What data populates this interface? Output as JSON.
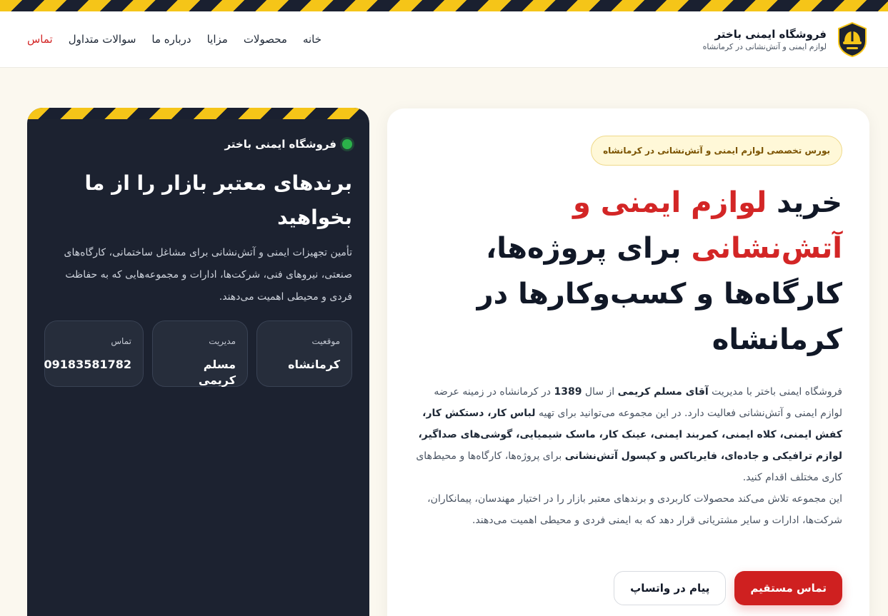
{
  "brand": {
    "title": "فروشگاه ایمنی باختر",
    "subtitle": "لوازم ایمنی و آتش‌نشانی در کرمانشاه"
  },
  "nav": {
    "home": "خانه",
    "products": "محصولات",
    "features": "مزایا",
    "about": "درباره ما",
    "faq": "سوالات متداول",
    "contact": "تماس"
  },
  "hero": {
    "badge": "بورس تخصصی لوازم ایمنی و آتش‌نشانی در کرمانشاه",
    "title_1": "خرید ",
    "title_highlight_1": "لوازم ایمنی و",
    "title_highlight_2": "آتش‌نشانی",
    "title_2": " برای پروژه‌ها، کارگاه‌ها و کسب‌وکارها در کرمانشاه",
    "p1_a": "فروشگاه ایمنی باختر با مدیریت ",
    "p1_manager": "آقای مسلم کریمی",
    "p1_b": " از سال ",
    "p1_year": "1389",
    "p1_c": " در کرمانشاه در زمینه عرضه لوازم ایمنی و آتش‌نشانی فعالیت دارد. در این مجموعه می‌توانید برای تهیه ",
    "p1_products": "لباس کار، دستکش کار، کفش ایمنی، کلاه ایمنی، کمربند ایمنی، عینک کار، ماسک شیمیایی، گوشی‌های صداگیر، لوازم ترافیکی و جاده‌ای، فایرباکس و کپسول آتش‌نشانی",
    "p1_d": " برای پروژه‌ها، کارگاه‌ها و محیط‌های کاری مختلف اقدام کنید.",
    "p2": "این مجموعه تلاش می‌کند محصولات کاربردی و برندهای معتبر بازار را در اختیار مهندسان، پیمانکاران، شرکت‌ها، ادارات و سایر مشتریانی قرار دهد که به ایمنی فردی و محیطی اهمیت می‌دهند.",
    "btn_primary": "تماس مستقیم",
    "btn_secondary": "پیام در واتساپ"
  },
  "side": {
    "status": "فروشگاه ایمنی باختر",
    "title": "برندهای معتبر بازار را از ما بخواهید",
    "desc": "تأمین تجهیزات ایمنی و آتش‌نشانی برای مشاغل ساختمانی، کارگاه‌های صنعتی، نیروهای فنی، شرکت‌ها، ادارات و مجموعه‌هایی که به حفاظت فردی و محیطی اهمیت می‌دهند.",
    "info": [
      {
        "label": "موقعیت",
        "value": "کرمانشاه"
      },
      {
        "label": "مدیریت",
        "value": "مسلم کریمی"
      },
      {
        "label": "تماس",
        "value": "09183581782"
      }
    ]
  },
  "colors": {
    "accent_red": "#d32626",
    "accent_yellow": "#f5c518",
    "dark": "#1c2230",
    "status_green": "#2bb34a"
  },
  "icons": {
    "logo": "helmet-shield-icon",
    "status": "status-dot-icon"
  }
}
